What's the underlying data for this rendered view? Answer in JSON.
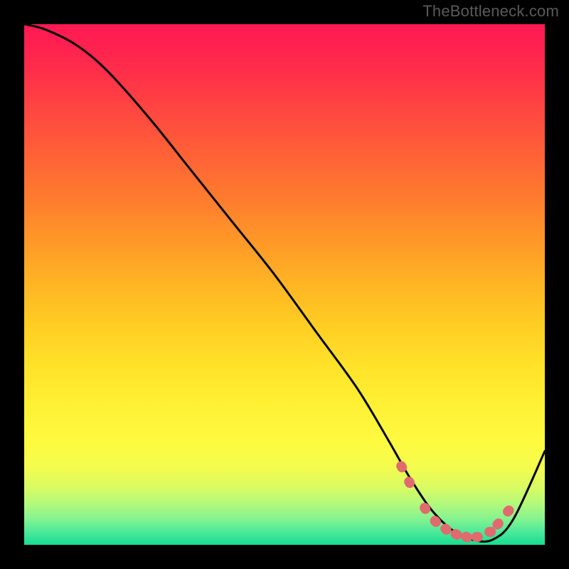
{
  "watermark": "TheBottleneck.com",
  "colors": {
    "frame": "#000000",
    "curve": "#000000",
    "marker_fill": "#e06a6e",
    "gradient_stops": [
      {
        "offset": 0.0,
        "color": "#ff1a52"
      },
      {
        "offset": 0.04,
        "color": "#ff2050"
      },
      {
        "offset": 0.1,
        "color": "#ff3149"
      },
      {
        "offset": 0.18,
        "color": "#ff4b3f"
      },
      {
        "offset": 0.26,
        "color": "#ff6436"
      },
      {
        "offset": 0.34,
        "color": "#ff7d2e"
      },
      {
        "offset": 0.42,
        "color": "#ff9928"
      },
      {
        "offset": 0.5,
        "color": "#ffb524"
      },
      {
        "offset": 0.58,
        "color": "#ffce24"
      },
      {
        "offset": 0.66,
        "color": "#ffe32a"
      },
      {
        "offset": 0.74,
        "color": "#fff236"
      },
      {
        "offset": 0.8,
        "color": "#fffa40"
      },
      {
        "offset": 0.85,
        "color": "#f4fc4e"
      },
      {
        "offset": 0.89,
        "color": "#d9fb63"
      },
      {
        "offset": 0.92,
        "color": "#b4f97b"
      },
      {
        "offset": 0.95,
        "color": "#85f38f"
      },
      {
        "offset": 0.975,
        "color": "#4de99a"
      },
      {
        "offset": 1.0,
        "color": "#17dd90"
      }
    ]
  },
  "chart_data": {
    "type": "line",
    "title": "",
    "xlabel": "",
    "ylabel": "",
    "xlim": [
      0,
      100
    ],
    "ylim": [
      0,
      100
    ],
    "series": [
      {
        "name": "curve",
        "x": [
          0,
          4,
          10,
          16,
          24,
          32,
          40,
          48,
          56,
          64,
          70,
          74,
          78,
          82,
          86,
          90,
          94,
          100
        ],
        "y": [
          100,
          99,
          96,
          91,
          82,
          72,
          62,
          52,
          41,
          30,
          20,
          13,
          7,
          3,
          1,
          1,
          5,
          18
        ]
      }
    ],
    "markers": {
      "name": "highlight",
      "points": [
        {
          "x": 72.5,
          "y": 15.0
        },
        {
          "x": 74.0,
          "y": 12.0
        },
        {
          "x": 77.0,
          "y": 7.0
        },
        {
          "x": 79.0,
          "y": 4.5
        },
        {
          "x": 81.0,
          "y": 3.0
        },
        {
          "x": 83.0,
          "y": 2.0
        },
        {
          "x": 85.0,
          "y": 1.5
        },
        {
          "x": 87.0,
          "y": 1.5
        },
        {
          "x": 89.5,
          "y": 2.5
        },
        {
          "x": 91.0,
          "y": 4.0
        },
        {
          "x": 93.0,
          "y": 6.5
        }
      ]
    }
  }
}
